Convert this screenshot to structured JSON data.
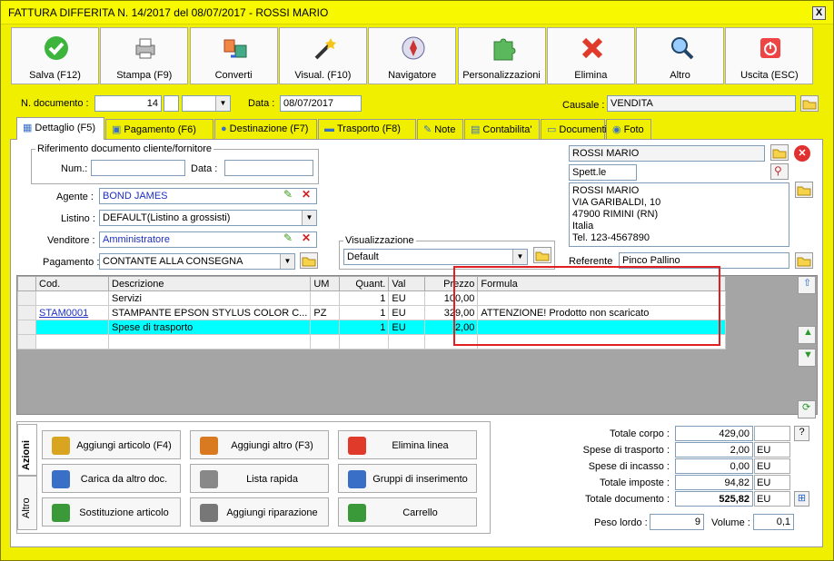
{
  "window": {
    "title": "FATTURA DIFFERITA N. 14/2017 del 08/07/2017 - ROSSI MARIO",
    "close": "X"
  },
  "toolbar": [
    {
      "name": "save-button",
      "icon": "check-icon",
      "label": "Salva (F12)"
    },
    {
      "name": "print-button",
      "icon": "printer-icon",
      "label": "Stampa (F9)"
    },
    {
      "name": "convert-button",
      "icon": "convert-icon",
      "label": "Converti"
    },
    {
      "name": "preview-button",
      "icon": "magic-wand-icon",
      "label": "Visual. (F10)"
    },
    {
      "name": "navigator-button",
      "icon": "compass-icon",
      "label": "Navigatore"
    },
    {
      "name": "customize-button",
      "icon": "puzzle-icon",
      "label": "Personalizzazioni"
    },
    {
      "name": "delete-button",
      "icon": "x-icon",
      "label": "Elimina"
    },
    {
      "name": "other-button",
      "icon": "magnifier-icon",
      "label": "Altro"
    },
    {
      "name": "exit-button",
      "icon": "power-icon",
      "label": "Uscita (ESC)"
    }
  ],
  "header": {
    "doc_label": "N. documento :",
    "doc_number": "14",
    "date_label": "Data :",
    "date": "08/07/2017",
    "causale_label": "Causale :",
    "causale": "VENDITA"
  },
  "tabs": [
    "Dettaglio (F5)",
    "Pagamento (F6)",
    "Destinazione (F7)",
    "Trasporto (F8)",
    "Note",
    "Contabilita'",
    "Documenti",
    "Foto"
  ],
  "ref": {
    "legend": "Riferimento documento cliente/fornitore",
    "num_label": "Num.:",
    "date_label": "Data :"
  },
  "fields": {
    "agente_label": "Agente :",
    "agente": "BOND JAMES",
    "listino_label": "Listino :",
    "listino": "DEFAULT(Listino a grossisti)",
    "venditore_label": "Venditore :",
    "venditore": "Amministratore",
    "pagamento_label": "Pagamento :",
    "pagamento": "CONTANTE ALLA CONSEGNA",
    "vis_legend": "Visualizzazione",
    "vis": "Default"
  },
  "customer": {
    "name": "ROSSI MARIO",
    "salutation": "Spett.le",
    "address": [
      "ROSSI MARIO",
      "VIA GARIBALDI, 10",
      "47900 RIMINI (RN)",
      "Italia",
      "Tel. 123-4567890"
    ],
    "ref_label": "Referente",
    "ref": "Pinco Pallino"
  },
  "grid": {
    "headers": [
      "Cod.",
      "Descrizione",
      "UM",
      "Quant.",
      "Val",
      "Prezzo",
      "Formula"
    ],
    "rows": [
      {
        "cod": "",
        "desc": "Servizi",
        "um": "",
        "qty": "1",
        "val": "EU",
        "price": "100,00",
        "formula": ""
      },
      {
        "cod": "STAM0001",
        "desc": "STAMPANTE EPSON STYLUS COLOR C...",
        "um": "PZ",
        "qty": "1",
        "val": "EU",
        "price": "329,00",
        "formula": "ATTENZIONE! Prodotto non scaricato"
      },
      {
        "cod": "",
        "desc": "Spese di trasporto",
        "um": "",
        "qty": "1",
        "val": "EU",
        "price": "2,00",
        "formula": ""
      }
    ]
  },
  "side_tabs": [
    "Azioni",
    "Altro"
  ],
  "actions": [
    {
      "name": "add-article-button",
      "label": "Aggiungi articolo (F4)"
    },
    {
      "name": "add-other-button",
      "label": "Aggiungi altro (F3)"
    },
    {
      "name": "delete-line-button",
      "label": "Elimina linea"
    },
    {
      "name": "load-doc-button",
      "label": "Carica da altro doc."
    },
    {
      "name": "quick-list-button",
      "label": "Lista rapida"
    },
    {
      "name": "insert-groups-button",
      "label": "Gruppi di inserimento"
    },
    {
      "name": "replace-article-button",
      "label": "Sostituzione articolo"
    },
    {
      "name": "add-repair-button",
      "label": "Aggiungi riparazione"
    },
    {
      "name": "cart-button",
      "label": "Carrello"
    }
  ],
  "totals": [
    {
      "label": "Totale corpo :",
      "value": "429,00",
      "unit": ""
    },
    {
      "label": "Spese di trasporto :",
      "value": "2,00",
      "unit": "EU"
    },
    {
      "label": "Spese di incasso :",
      "value": "0,00",
      "unit": "EU"
    },
    {
      "label": "Totale imposte :",
      "value": "94,82",
      "unit": "EU"
    },
    {
      "label": "Totale documento :",
      "value": "525,82",
      "unit": "EU"
    }
  ],
  "weight": {
    "label": "Peso lordo :",
    "value": "9",
    "vol_label": "Volume :",
    "vol": "0,1"
  },
  "help": "?"
}
